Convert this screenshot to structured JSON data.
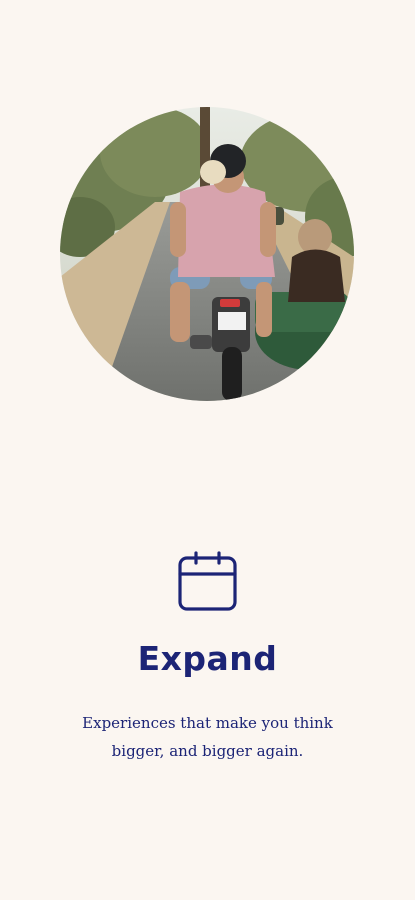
{
  "onboarding": {
    "image": {
      "description_icon": "photo-motorcycle-sidecar"
    },
    "icon": "calendar-icon",
    "title": "Expand",
    "subtitle": "Experiences that make you think bigger, and bigger again."
  },
  "colors": {
    "background": "#fbf6f1",
    "text_primary": "#1c2476",
    "icon_stroke": "#1c2476"
  }
}
